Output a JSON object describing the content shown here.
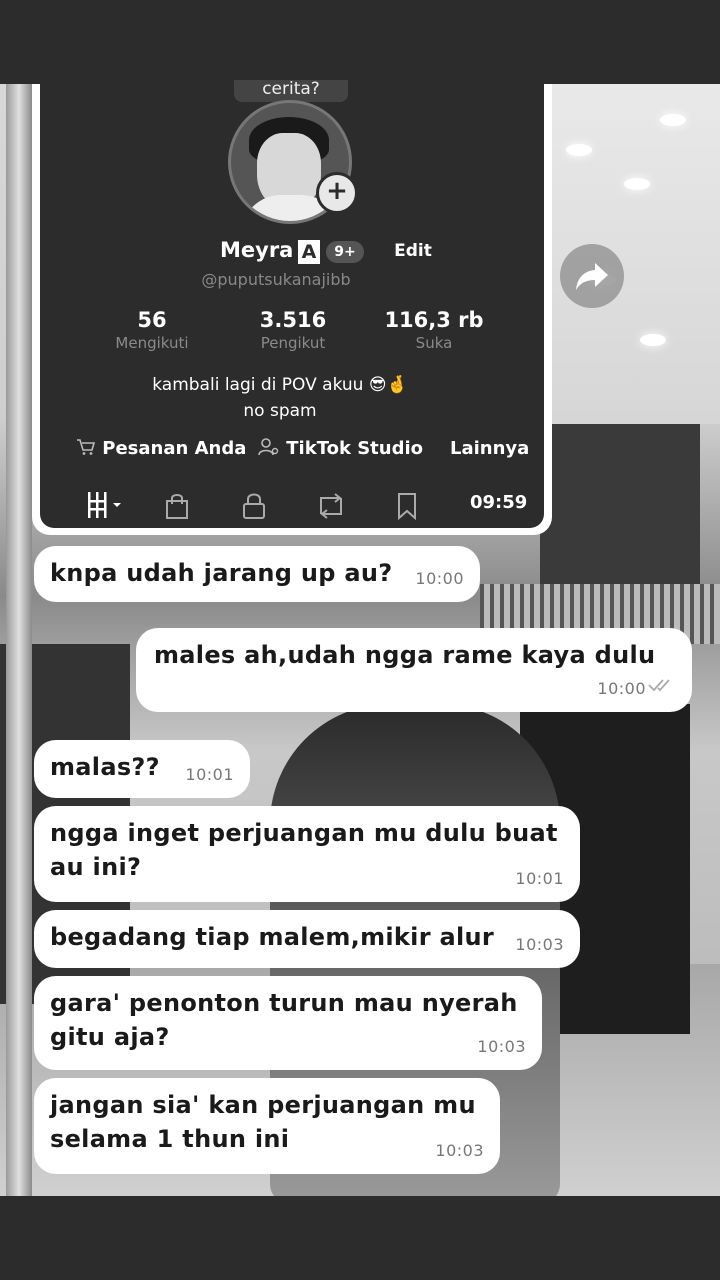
{
  "profile": {
    "top_tag": "cerita?",
    "name": "Meyra",
    "name_badge": "A",
    "notif_badge": "9+",
    "edit_label": "Edit",
    "handle": "@puputsukanajibb",
    "stats": [
      {
        "value": "56",
        "label": "Mengikuti"
      },
      {
        "value": "3.516",
        "label": "Pengikut"
      },
      {
        "value": "116,3 rb",
        "label": "Suka"
      }
    ],
    "bio_line1": "kambali lagi di POV akuu 😎🤞",
    "bio_line2": "no spam",
    "links": {
      "orders": "Pesanan Anda",
      "studio": "TikTok Studio",
      "more": "Lainnya"
    },
    "clock": "09:59"
  },
  "messages": [
    {
      "text": "knpa udah jarang up au?",
      "time": "10:00",
      "side": "in"
    },
    {
      "text": "males ah,udah ngga rame kaya dulu",
      "time": "10:00",
      "side": "out"
    },
    {
      "text": "malas??",
      "time": "10:01",
      "side": "in"
    },
    {
      "text": "ngga inget perjuangan mu dulu buat au ini?",
      "time": "10:01",
      "side": "in"
    },
    {
      "text": "begadang tiap malem,mikir alur",
      "time": "10:03",
      "side": "in"
    },
    {
      "text": "gara' penonton turun mau nyerah gitu aja?",
      "time": "10:03",
      "side": "in"
    },
    {
      "text": "jangan sia' kan perjuangan mu selama 1 thun ini",
      "time": "10:03",
      "side": "in"
    }
  ],
  "icons": {
    "share": "share-arrow-icon",
    "cart": "cart-icon",
    "studio": "person-settings-icon",
    "menu": "grid-menu-icon",
    "bag": "shopping-bag-icon",
    "lock": "lock-icon",
    "repost": "repost-icon",
    "bookmark": "bookmark-icon",
    "read": "double-check-icon"
  }
}
